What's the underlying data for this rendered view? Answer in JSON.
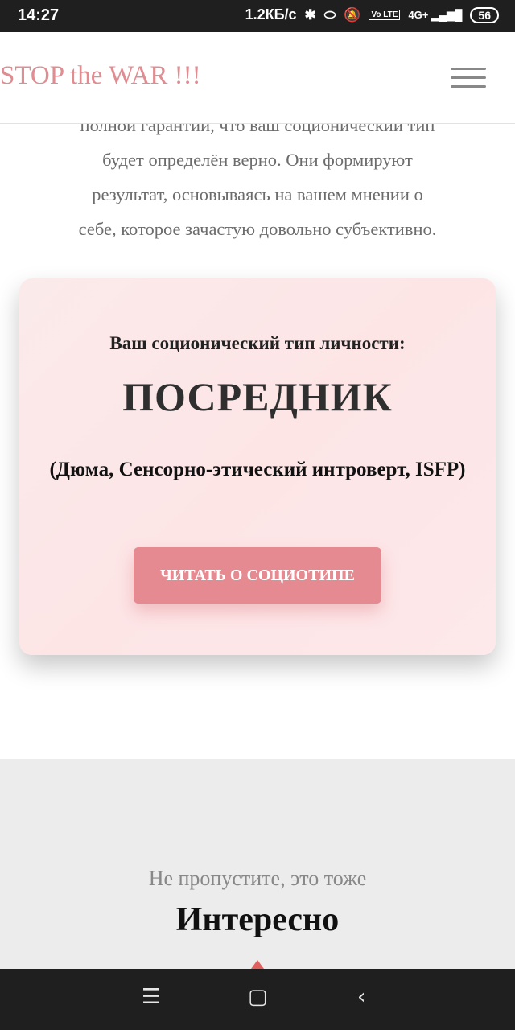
{
  "status_bar": {
    "time": "14:27",
    "speed": "1.2КБ/с",
    "icons": [
      "bluetooth-icon",
      "toggle-icon",
      "mute-bell-icon",
      "volte-icon",
      "signal-icon"
    ],
    "lte_label": "Vo LTE",
    "net_label": "4G+",
    "battery": "56"
  },
  "header": {
    "logo": "STOP the WAR !!!",
    "menu_icon": "hamburger-menu-icon"
  },
  "intro": {
    "lines": [
      "полной гарантии, что ваш соционический тип",
      "будет определён верно. Они формируют",
      "результат, основываясь на вашем мнении о",
      "себе, которое зачастую довольно субъективно."
    ]
  },
  "result_card": {
    "label": "Ваш соционический тип личности:",
    "type": "ПОСРЕДНИК",
    "description": "(Дюма, Сенсорно-этический интроверт, ISFP)",
    "button": "ЧИТАТЬ О СОЦИОТИПЕ"
  },
  "section": {
    "subtitle": "Не пропустите, это тоже",
    "title": "Интересно"
  },
  "nav_bar": {
    "icons": [
      "recent-apps-icon",
      "home-icon",
      "back-icon"
    ]
  },
  "colors": {
    "accent": "#e48a90",
    "logo": "#e08c91",
    "card_bg": "#fde6e7",
    "section_bg": "#ececec"
  }
}
